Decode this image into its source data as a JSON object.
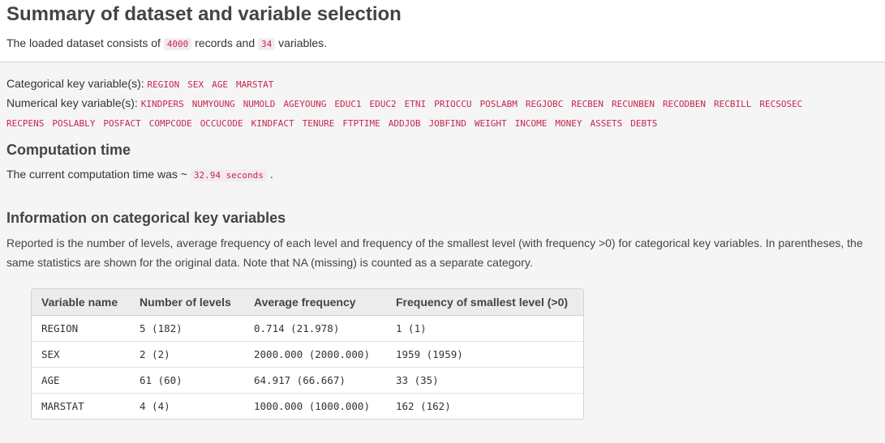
{
  "header": {
    "title": "Summary of dataset and variable selection",
    "dataset_prefix": "The loaded dataset consists of",
    "records": "4000",
    "records_suffix": "records and",
    "variables": "34",
    "variables_suffix": "variables."
  },
  "key_variables": {
    "categorical_label": "Categorical key variable(s):",
    "categorical": [
      "REGION",
      "SEX",
      "AGE",
      "MARSTAT"
    ],
    "numerical_label": "Numerical key variable(s):",
    "numerical_line1": [
      "KINDPERS",
      "NUMYOUNG",
      "NUMOLD",
      "AGEYOUNG",
      "EDUC1",
      "EDUC2",
      "ETNI",
      "PRIOCCU",
      "POSLABM",
      "REGJOBC",
      "RECBEN",
      "RECUNBEN",
      "RECODBEN",
      "RECBILL",
      "RECSOSEC"
    ],
    "numerical_line2": [
      "RECPENS",
      "POSLABLY",
      "POSFACT",
      "COMPCODE",
      "OCCUCODE",
      "KINDFACT",
      "TENURE",
      "FTPTIME",
      "ADDJOB",
      "JOBFIND",
      "WEIGHT",
      "INCOME",
      "MONEY",
      "ASSETS",
      "DEBTS"
    ]
  },
  "computation": {
    "heading": "Computation time",
    "prefix": "The current computation time was ~",
    "value": "32.94 seconds",
    "suffix": "."
  },
  "categorical_info": {
    "heading": "Information on categorical key variables",
    "line1": "Reported is the number of levels, average frequency of each level and frequency of the smallest level (with frequency >0) for categorical key variables. In parentheses, the",
    "line2": "same statistics are shown for the original data. Note that NA (missing) is counted as a separate category.",
    "columns": [
      "Variable name",
      "Number of levels",
      "Average frequency",
      "Frequency of smallest level (>0)"
    ],
    "rows": [
      [
        "REGION",
        "5 (182)",
        "0.714 (21.978)",
        "1 (1)"
      ],
      [
        "SEX",
        "2 (2)",
        "2000.000 (2000.000)",
        "1959 (1959)"
      ],
      [
        "AGE",
        "61 (60)",
        "64.917 (66.667)",
        "33 (35)"
      ],
      [
        "MARSTAT",
        "4 (4)",
        "1000.000 (1000.000)",
        "162 (162)"
      ]
    ]
  }
}
